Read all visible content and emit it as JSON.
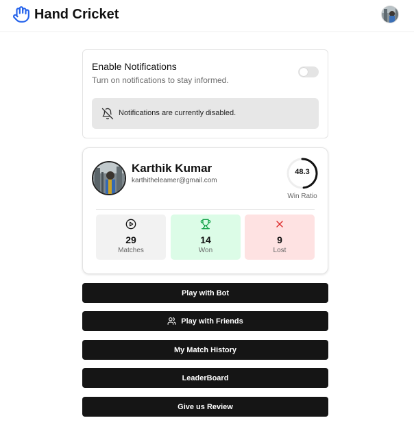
{
  "header": {
    "app_title": "Hand Cricket",
    "logo_icon": "hand-icon",
    "avatar_icon": "user-avatar"
  },
  "notifications": {
    "title": "Enable Notifications",
    "subtitle": "Turn on notifications to stay informed.",
    "toggle_on": false,
    "status_icon": "bell-off-icon",
    "status_text": "Notifications are currently disabled."
  },
  "profile": {
    "name": "Karthik Kumar",
    "email": "karthitheleamer@gmail.com",
    "win_ratio": "48.3",
    "win_ratio_label": "Win Ratio",
    "stats": {
      "matches": {
        "value": "29",
        "label": "Matches",
        "icon": "play-circle-icon"
      },
      "won": {
        "value": "14",
        "label": "Won",
        "icon": "trophy-icon",
        "color": "#16a34a"
      },
      "lost": {
        "value": "9",
        "label": "Lost",
        "icon": "x-icon",
        "color": "#dc2626"
      }
    }
  },
  "actions": {
    "play_bot": "Play with Bot",
    "play_friends": "Play with Friends",
    "history": "My Match History",
    "leaderboard": "LeaderBoard",
    "review": "Give us Review"
  },
  "colors": {
    "accent_blue": "#2563eb",
    "button_bg": "#151515",
    "won_bg": "#dcfce7",
    "lost_bg": "#fee2e2"
  }
}
